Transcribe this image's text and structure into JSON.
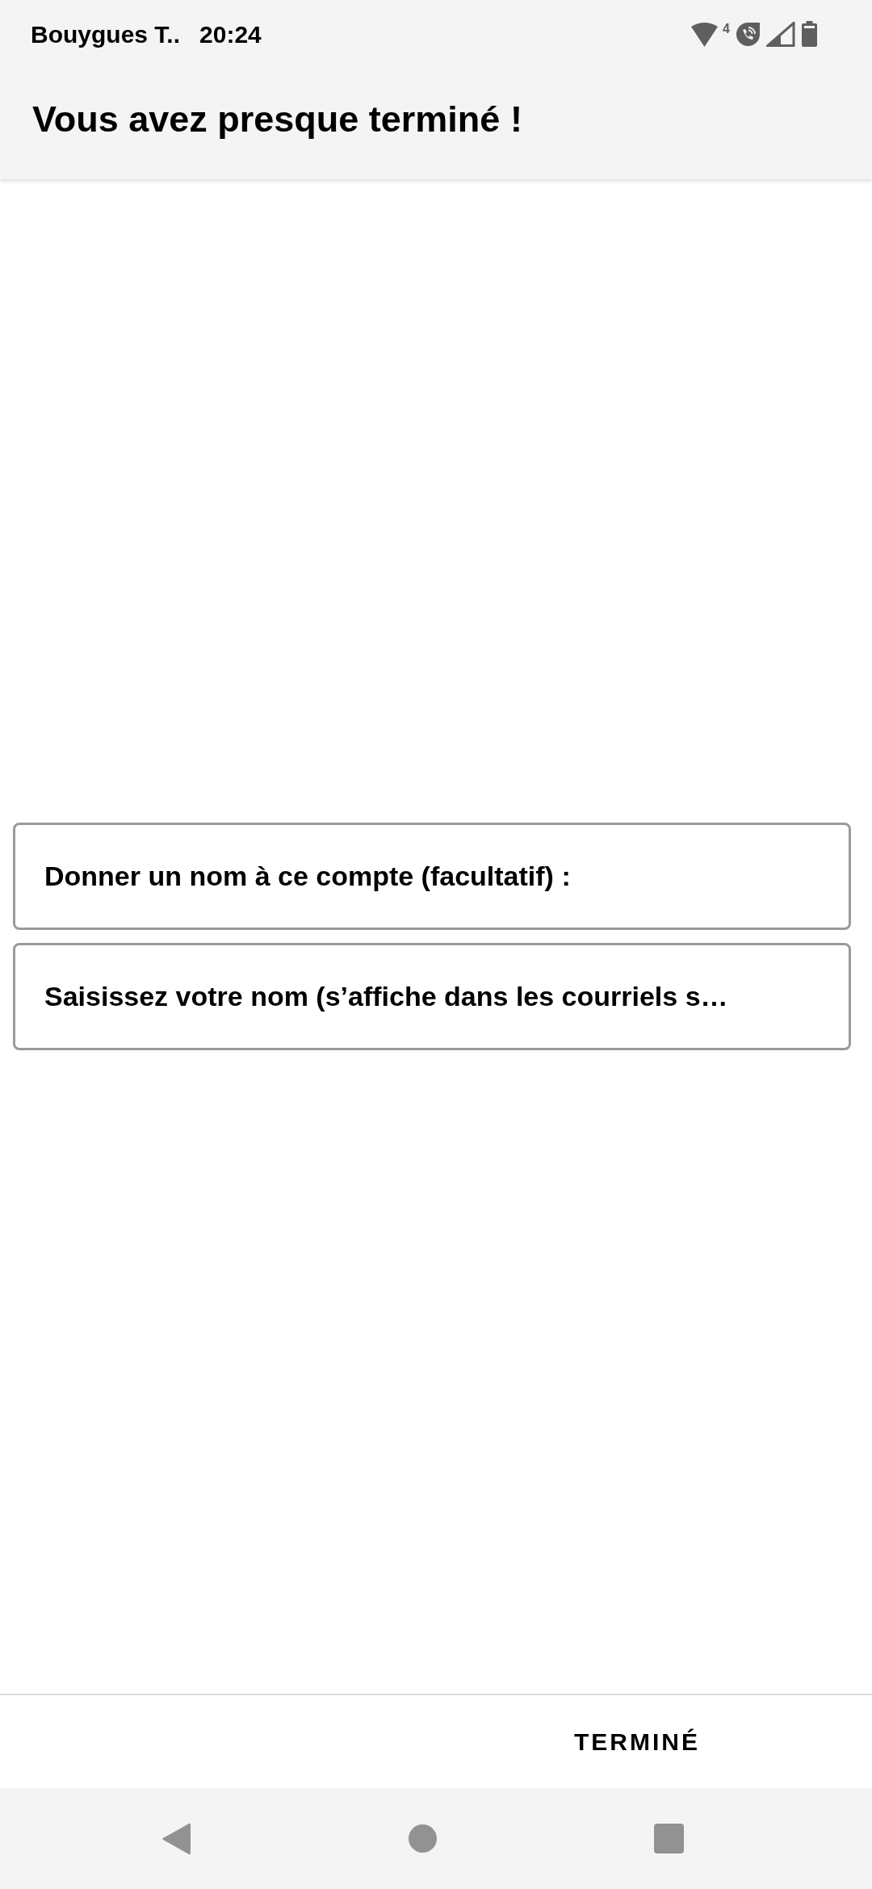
{
  "status_bar": {
    "carrier": "Bouygues T..",
    "time": "20:24",
    "wifi_badge": "4"
  },
  "app_bar": {
    "title": "Vous avez presque terminé !"
  },
  "fields": [
    {
      "placeholder": "Donner un nom à ce compte (facultatif) :"
    },
    {
      "placeholder": "Saisissez votre nom (s’affiche dans les courriels s…"
    }
  ],
  "footer": {
    "button": "TERMINÉ"
  }
}
